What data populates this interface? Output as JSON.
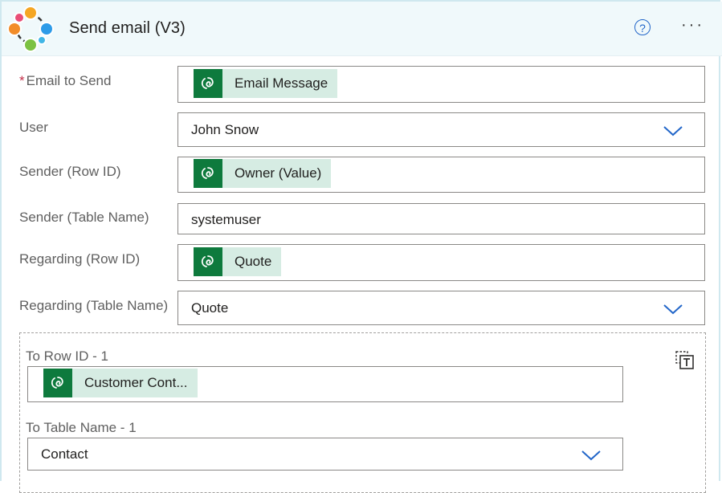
{
  "header": {
    "title": "Send email (V3)",
    "help_glyph": "?",
    "more_glyph": "···"
  },
  "fields": {
    "email_to_send": {
      "required_mark": "*",
      "label": "Email to Send",
      "token": "Email Message"
    },
    "user": {
      "label": "User",
      "value": "John Snow"
    },
    "sender_row_id": {
      "label": "Sender (Row ID)",
      "token": "Owner (Value)"
    },
    "sender_table_name": {
      "label": "Sender (Table Name)",
      "value": "systemuser"
    },
    "regarding_row_id": {
      "label": "Regarding (Row ID)",
      "token": "Quote"
    },
    "regarding_table_name": {
      "label": "Regarding (Table Name)",
      "value": "Quote"
    }
  },
  "to_array": {
    "row_id": {
      "label": "To Row ID - 1",
      "token": "Customer Cont..."
    },
    "table_name": {
      "label": "To Table Name - 1",
      "value": "Contact"
    }
  },
  "colors": {
    "accent_blue": "#2266c9",
    "token_green": "#0e7a3d",
    "token_bg": "#d6ece3",
    "header_bg": "#f0f9fb"
  },
  "icons": {
    "logo": "dataverse-connector-logo",
    "token": "dataverse-icon",
    "dropdown": "chevron-down-icon",
    "switch": "switch-to-text-mode-icon"
  }
}
